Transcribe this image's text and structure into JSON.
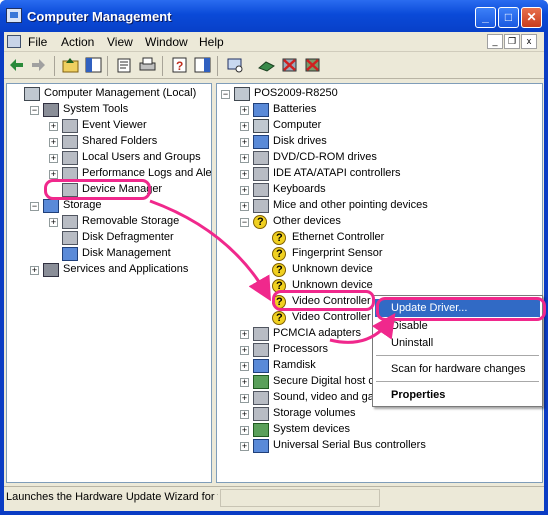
{
  "window": {
    "title": "Computer Management"
  },
  "menu": [
    "File",
    "Action",
    "View",
    "Window",
    "Help"
  ],
  "mdi_controls": [
    "_",
    "❐",
    "x"
  ],
  "left_tree": [
    {
      "label": "Computer Management (Local)",
      "level": 0,
      "expander": "",
      "icon": "computer-icon"
    },
    {
      "label": "System Tools",
      "level": 1,
      "expander": "−",
      "icon": "tools-icon"
    },
    {
      "label": "Event Viewer",
      "level": 2,
      "expander": "+",
      "icon": "event-viewer-icon"
    },
    {
      "label": "Shared Folders",
      "level": 2,
      "expander": "+",
      "icon": "shared-folders-icon"
    },
    {
      "label": "Local Users and Groups",
      "level": 2,
      "expander": "+",
      "icon": "users-icon"
    },
    {
      "label": "Performance Logs and Alerts",
      "level": 2,
      "expander": "+",
      "icon": "performance-icon"
    },
    {
      "label": "Device Manager",
      "level": 2,
      "expander": "",
      "icon": "device-manager-icon"
    },
    {
      "label": "Storage",
      "level": 1,
      "expander": "−",
      "icon": "storage-icon"
    },
    {
      "label": "Removable Storage",
      "level": 2,
      "expander": "+",
      "icon": "removable-storage-icon"
    },
    {
      "label": "Disk Defragmenter",
      "level": 2,
      "expander": "",
      "icon": "defrag-icon"
    },
    {
      "label": "Disk Management",
      "level": 2,
      "expander": "",
      "icon": "disk-management-icon"
    },
    {
      "label": "Services and Applications",
      "level": 1,
      "expander": "+",
      "icon": "services-icon"
    }
  ],
  "right_tree": [
    {
      "label": "POS2009-R8250",
      "level": 0,
      "expander": "−",
      "icon": "computer-icon"
    },
    {
      "label": "Batteries",
      "level": 1,
      "expander": "+",
      "icon": "battery-icon"
    },
    {
      "label": "Computer",
      "level": 1,
      "expander": "+",
      "icon": "computer-icon"
    },
    {
      "label": "Disk drives",
      "level": 1,
      "expander": "+",
      "icon": "disk-drive-icon"
    },
    {
      "label": "DVD/CD-ROM drives",
      "level": 1,
      "expander": "+",
      "icon": "cdrom-icon"
    },
    {
      "label": "IDE ATA/ATAPI controllers",
      "level": 1,
      "expander": "+",
      "icon": "ide-controller-icon"
    },
    {
      "label": "Keyboards",
      "level": 1,
      "expander": "+",
      "icon": "keyboard-icon"
    },
    {
      "label": "Mice and other pointing devices",
      "level": 1,
      "expander": "+",
      "icon": "mouse-icon"
    },
    {
      "label": "Other devices",
      "level": 1,
      "expander": "−",
      "icon": "unknown-device-icon"
    },
    {
      "label": "Ethernet Controller",
      "level": 2,
      "expander": "",
      "icon": "warning-device-icon"
    },
    {
      "label": "Fingerprint Sensor",
      "level": 2,
      "expander": "",
      "icon": "warning-device-icon"
    },
    {
      "label": "Unknown device",
      "level": 2,
      "expander": "",
      "icon": "warning-device-icon"
    },
    {
      "label": "Unknown device",
      "level": 2,
      "expander": "",
      "icon": "warning-device-icon"
    },
    {
      "label": "Video Controller",
      "level": 2,
      "expander": "",
      "icon": "warning-device-icon"
    },
    {
      "label": "Video Controller",
      "level": 2,
      "expander": "",
      "icon": "warning-device-icon"
    },
    {
      "label": "PCMCIA adapters",
      "level": 1,
      "expander": "+",
      "icon": "pcmcia-icon"
    },
    {
      "label": "Processors",
      "level": 1,
      "expander": "+",
      "icon": "processor-icon"
    },
    {
      "label": "Ramdisk",
      "level": 1,
      "expander": "+",
      "icon": "ramdisk-icon"
    },
    {
      "label": "Secure Digital host c",
      "level": 1,
      "expander": "+",
      "icon": "sd-host-icon"
    },
    {
      "label": "Sound, video and ga",
      "level": 1,
      "expander": "+",
      "icon": "sound-icon"
    },
    {
      "label": "Storage volumes",
      "level": 1,
      "expander": "+",
      "icon": "storage-volume-icon"
    },
    {
      "label": "System devices",
      "level": 1,
      "expander": "+",
      "icon": "system-devices-icon"
    },
    {
      "label": "Universal Serial Bus controllers",
      "level": 1,
      "expander": "+",
      "icon": "usb-icon"
    }
  ],
  "context_menu": {
    "update": "Update Driver...",
    "disable": "Disable",
    "uninstall": "Uninstall",
    "scan": "Scan for hardware changes",
    "properties": "Properties"
  },
  "status": {
    "text": "Launches the Hardware Update Wizard for the selected device."
  },
  "colors": {
    "highlight": "#f0288c",
    "selection": "#316ac5",
    "titlebar": "#0a4ad8"
  }
}
